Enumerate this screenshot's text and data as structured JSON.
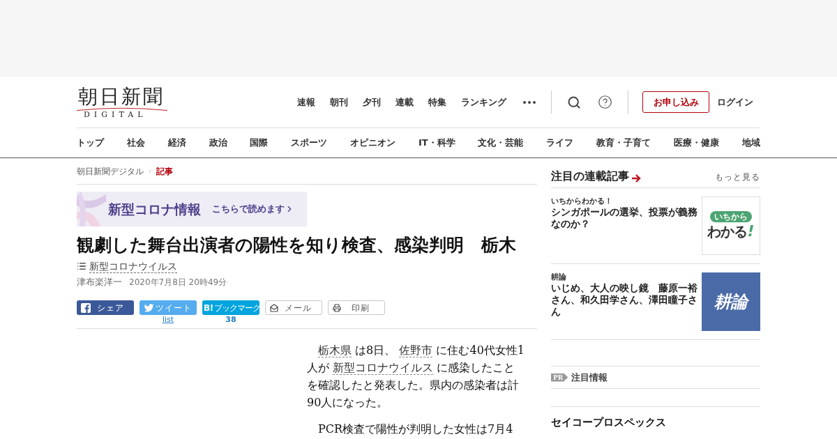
{
  "logo": {
    "name": "朝日新聞",
    "sub": "DIGITAL"
  },
  "top_nav": {
    "items": [
      "速報",
      "朝刊",
      "夕刊",
      "連載",
      "特集",
      "ランキング"
    ],
    "subscribe": "お申し込み",
    "login": "ログイン"
  },
  "categories": [
    "トップ",
    "社会",
    "経済",
    "政治",
    "国際",
    "スポーツ",
    "オピニオン",
    "IT・科学",
    "文化・芸能",
    "ライフ",
    "教育・子育て",
    "医療・健康",
    "地域"
  ],
  "breadcrumb": [
    {
      "label": "朝日新聞デジタル",
      "current": false
    },
    {
      "label": "記事",
      "current": true
    }
  ],
  "banner": {
    "title": "新型コロナ情報",
    "link": "こちらで読めます"
  },
  "article": {
    "title": "観劇した舞台出演者の陽性を知り検査、感染判明　栃木",
    "tag": "新型コロナウイルス",
    "author": "津布楽洋一",
    "date": "2020年7月8日 20時49分",
    "share": [
      {
        "kind": "facebook",
        "label": "シェア"
      },
      {
        "kind": "twitter",
        "label": "ツイート",
        "count": "list"
      },
      {
        "kind": "hatena",
        "logo_text": "B!",
        "label": "ブックマーク",
        "count": "38"
      },
      {
        "kind": "mail",
        "label": "メール"
      },
      {
        "kind": "print",
        "label": "印刷"
      }
    ],
    "paragraphs": [
      [
        {
          "text": "栃木県",
          "link": true
        },
        {
          "text": " は8日、 ",
          "link": false
        },
        {
          "text": "佐野市",
          "link": true
        },
        {
          "text": " に住む40代女性1人が ",
          "link": false
        },
        {
          "text": "新型コロナウイルス",
          "link": true
        },
        {
          "text": " に感染したことを確認したと発表した。県内の感染者は計90人になった。",
          "link": false
        }
      ],
      [
        {
          "text": "PCR検査で陽性が判明した女性は7月4",
          "link": false
        }
      ]
    ]
  },
  "sidebar": {
    "title": "注目の連載記事",
    "more": "もっと見る",
    "items": [
      {
        "label": "いちからわかる！",
        "title": "シンガポールの選挙、投票が義務なのか？",
        "thumb": {
          "kind": "wakaru",
          "texts": [
            "いちから",
            "わかる",
            "!"
          ]
        }
      },
      {
        "label": "耕論",
        "title": "いじめ、大人の映し鏡　藤原一裕さん、和久田学さん、澤田瞳子さん",
        "thumb": {
          "kind": "koron",
          "texts": [
            "耕論"
          ]
        }
      }
    ],
    "pr": {
      "badge": "PR",
      "title": "注目情報"
    },
    "promo": {
      "title": "セイコープロスペックス"
    }
  }
}
